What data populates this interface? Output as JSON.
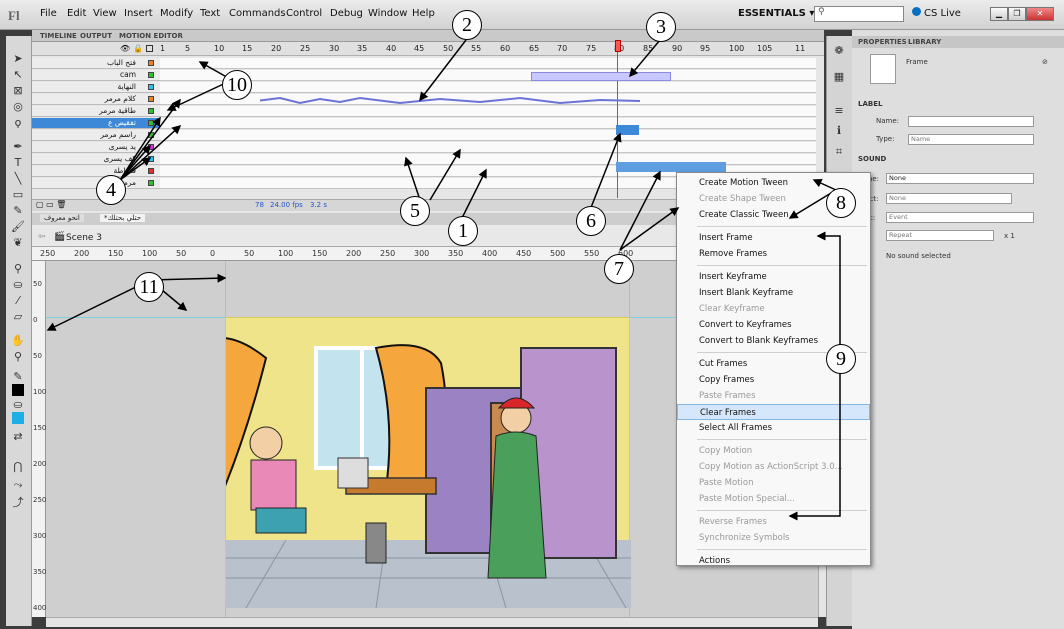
{
  "menubar": {
    "logo": "Fl",
    "items": [
      "File",
      "Edit",
      "View",
      "Insert",
      "Modify",
      "Text",
      "Commands",
      "Control",
      "Debug",
      "Window",
      "Help"
    ],
    "workspace": "ESSENTIALS ▾",
    "cs_live": "CS Live"
  },
  "timeline": {
    "tabs": [
      "TIMELINE",
      "OUTPUT",
      "MOTION EDITOR"
    ],
    "frame_numbers": [
      "1",
      "5",
      "10",
      "15",
      "20",
      "25",
      "30",
      "35",
      "40",
      "45",
      "50",
      "55",
      "60",
      "65",
      "70",
      "75",
      "80",
      "85",
      "90",
      "95",
      "100",
      "105",
      "11"
    ],
    "layers": [
      {
        "name": "فتح الباب",
        "color": "#f08020"
      },
      {
        "name": "cam",
        "color": "#30c030"
      },
      {
        "name": "النهاية",
        "color": "#30c0f0"
      },
      {
        "name": "كلام مرمر",
        "color": "#f08020"
      },
      {
        "name": "طاقية مرمر",
        "color": "#30c030"
      },
      {
        "name": "تفقيص ع",
        "color": "#30c030"
      },
      {
        "name": "راسم مرمر",
        "color": "#30c030"
      },
      {
        "name": "يد يسرى",
        "color": "#e030e0"
      },
      {
        "name": "كف يسرى",
        "color": "#30c0f0"
      },
      {
        "name": "قشاطة",
        "color": "#e03030"
      },
      {
        "name": "مرمر",
        "color": "#30c030"
      }
    ],
    "footer": {
      "frame": "78",
      "fps": "24.00 fps",
      "time": "3.2 s"
    }
  },
  "doctabs": [
    "انحو معروف",
    "*حتلي بحتلك"
  ],
  "scene": "Scene 3",
  "ruler_labels": [
    "250",
    "200",
    "150",
    "100",
    "50",
    "0",
    "50",
    "100",
    "150",
    "200",
    "250",
    "300",
    "350",
    "400",
    "450",
    "500",
    "550",
    "600"
  ],
  "vruler_labels": [
    "50",
    "0",
    "50",
    "100",
    "150",
    "200",
    "250",
    "300",
    "350",
    "400"
  ],
  "properties": {
    "tabs": [
      "PROPERTIES",
      "LIBRARY"
    ],
    "frame_label": "Frame",
    "label_section": "LABEL",
    "name_label": "Name:",
    "type_label": "Type:",
    "type_value": "Name",
    "sound_section": "SOUND",
    "sound_rows": [
      {
        "label": "Name:",
        "value": "None"
      },
      {
        "label": "Effect:",
        "value": "None"
      },
      {
        "label": "Sync:",
        "value": "Event"
      },
      {
        "label": "",
        "value": "Repeat",
        "extra": "x  1"
      }
    ],
    "no_sound": "No sound selected"
  },
  "context_menu": {
    "items": [
      {
        "label": "Create Motion Tween",
        "enabled": true
      },
      {
        "label": "Create Shape Tween",
        "enabled": false
      },
      {
        "label": "Create Classic Tween",
        "enabled": true
      },
      {
        "sep": true
      },
      {
        "label": "Insert Frame",
        "enabled": true
      },
      {
        "label": "Remove Frames",
        "enabled": true
      },
      {
        "sep": true
      },
      {
        "label": "Insert Keyframe",
        "enabled": true
      },
      {
        "label": "Insert Blank Keyframe",
        "enabled": true
      },
      {
        "label": "Clear Keyframe",
        "enabled": false
      },
      {
        "label": "Convert to Keyframes",
        "enabled": true
      },
      {
        "label": "Convert to Blank Keyframes",
        "enabled": true
      },
      {
        "sep": true
      },
      {
        "label": "Cut Frames",
        "enabled": true
      },
      {
        "label": "Copy Frames",
        "enabled": true
      },
      {
        "label": "Paste Frames",
        "enabled": false
      },
      {
        "label": "Clear Frames",
        "enabled": true,
        "highlight": true
      },
      {
        "label": "Select All Frames",
        "enabled": true
      },
      {
        "sep": true
      },
      {
        "label": "Copy Motion",
        "enabled": false
      },
      {
        "label": "Copy Motion as ActionScript 3.0...",
        "enabled": false
      },
      {
        "label": "Paste Motion",
        "enabled": false
      },
      {
        "label": "Paste Motion Special...",
        "enabled": false
      },
      {
        "sep": true
      },
      {
        "label": "Reverse Frames",
        "enabled": false
      },
      {
        "label": "Synchronize Symbols",
        "enabled": false
      },
      {
        "sep": true
      },
      {
        "label": "Actions",
        "enabled": true
      }
    ]
  },
  "callouts": [
    "1",
    "2",
    "3",
    "4",
    "5",
    "6",
    "7",
    "8",
    "9",
    "10",
    "11"
  ]
}
